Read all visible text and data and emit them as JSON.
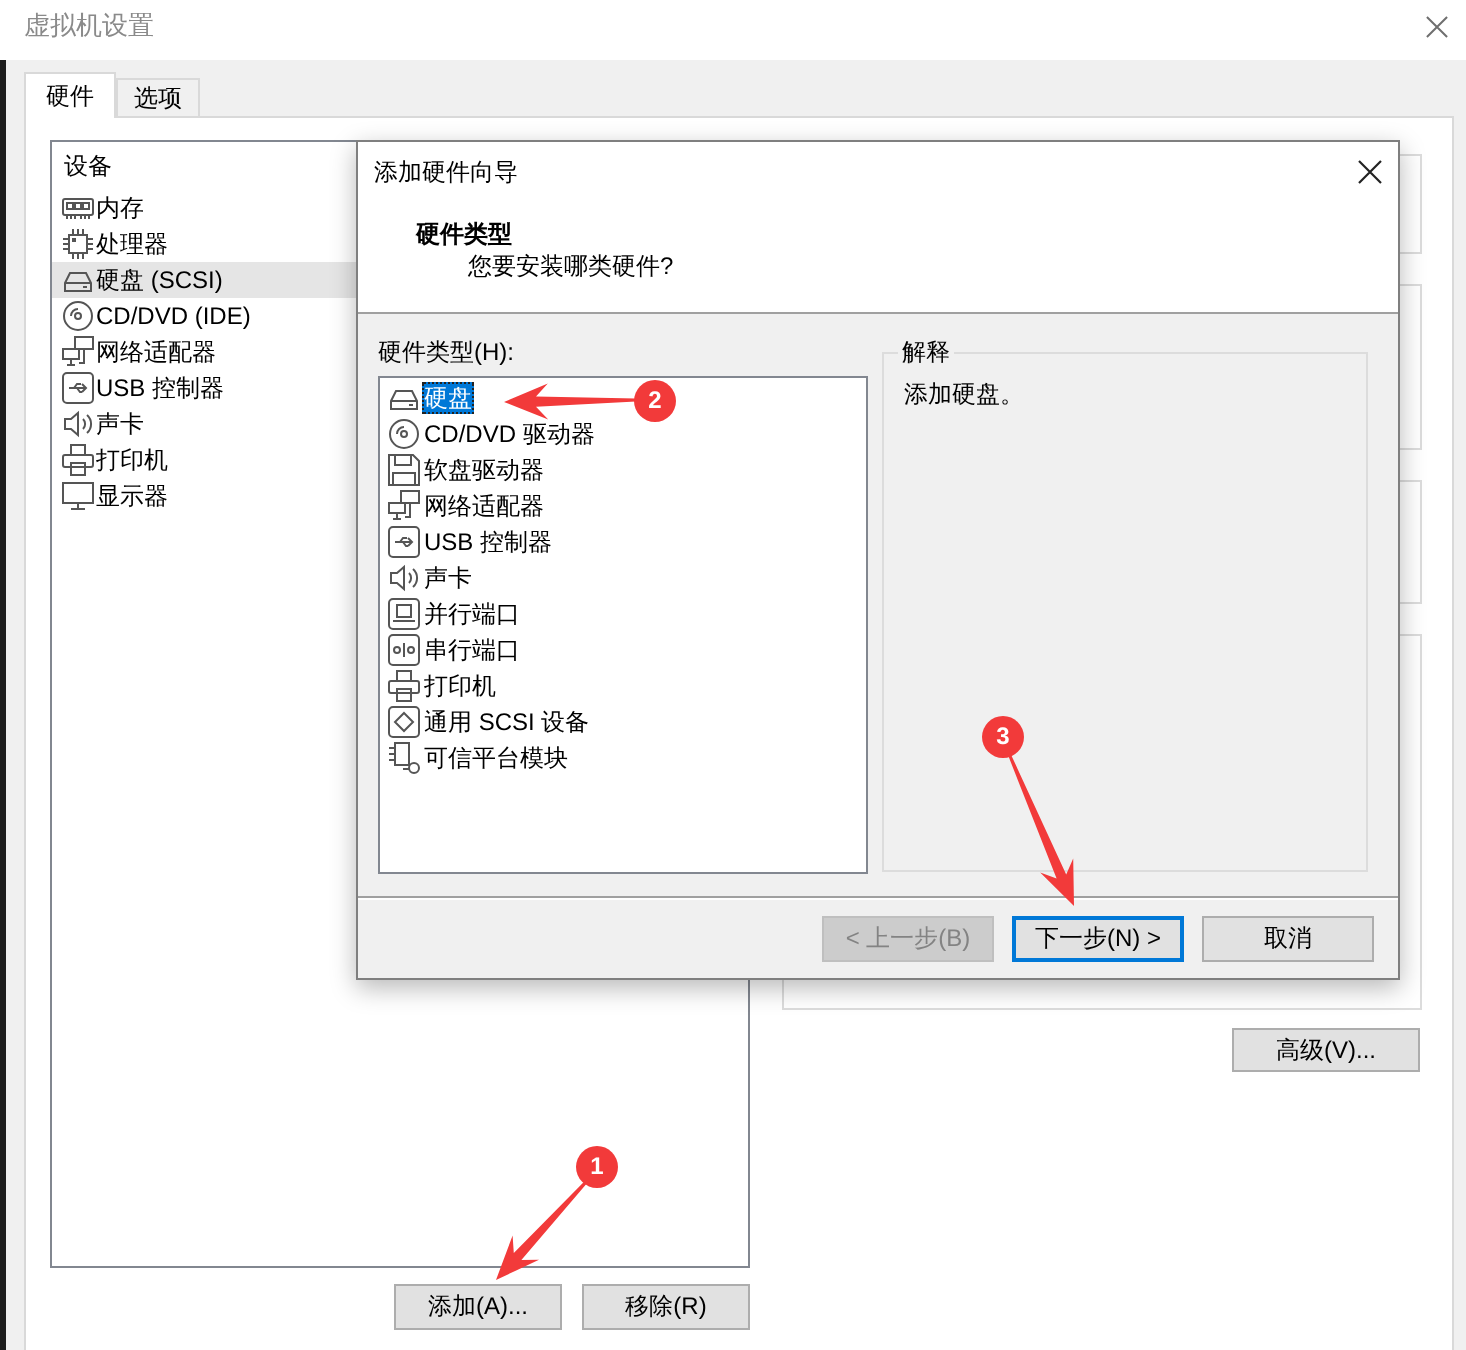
{
  "window": {
    "title": "虚拟机设置"
  },
  "tabs": [
    {
      "label": "硬件",
      "selected": true
    },
    {
      "label": "选项",
      "selected": false
    }
  ],
  "device_list": {
    "header": "设备",
    "items": [
      {
        "label": "内存",
        "kind": "memory",
        "selected": false
      },
      {
        "label": "处理器",
        "kind": "processor",
        "selected": false
      },
      {
        "label": "硬盘 (SCSI)",
        "kind": "hard_disk",
        "selected": true
      },
      {
        "label": "CD/DVD (IDE)",
        "kind": "optical",
        "selected": false
      },
      {
        "label": "网络适配器",
        "kind": "network",
        "selected": false
      },
      {
        "label": "USB 控制器",
        "kind": "usb",
        "selected": false
      },
      {
        "label": "声卡",
        "kind": "sound",
        "selected": false
      },
      {
        "label": "打印机",
        "kind": "printer",
        "selected": false
      },
      {
        "label": "显示器",
        "kind": "display",
        "selected": false
      }
    ]
  },
  "device_buttons": [
    {
      "label": "添加(A)..."
    },
    {
      "label": "移除(R)"
    }
  ],
  "advanced_button": {
    "label": "高级(V)..."
  },
  "wizard": {
    "title": "添加硬件向导",
    "heading": "硬件类型",
    "subheading": "您要安装哪类硬件?",
    "list_label": "硬件类型(H):",
    "items": [
      {
        "label": "硬盘",
        "kind": "hard_disk",
        "selected": true
      },
      {
        "label": "CD/DVD 驱动器",
        "kind": "optical",
        "selected": false
      },
      {
        "label": "软盘驱动器",
        "kind": "floppy",
        "selected": false
      },
      {
        "label": "网络适配器",
        "kind": "network",
        "selected": false
      },
      {
        "label": "USB 控制器",
        "kind": "usb",
        "selected": false
      },
      {
        "label": "声卡",
        "kind": "sound",
        "selected": false
      },
      {
        "label": "并行端口",
        "kind": "parallel",
        "selected": false
      },
      {
        "label": "串行端口",
        "kind": "serial",
        "selected": false
      },
      {
        "label": "打印机",
        "kind": "printer",
        "selected": false
      },
      {
        "label": "通用 SCSI 设备",
        "kind": "scsi",
        "selected": false
      },
      {
        "label": "可信平台模块",
        "kind": "tpm",
        "selected": false
      }
    ],
    "explanation": {
      "title": "解释",
      "text": "添加硬盘。"
    },
    "buttons": [
      {
        "label": "< 上一步(B)",
        "disabled": true,
        "default": false
      },
      {
        "label": "下一步(N) >",
        "disabled": false,
        "default": true
      },
      {
        "label": "取消",
        "disabled": false,
        "default": false
      }
    ]
  },
  "annotations": [
    {
      "number": "1"
    },
    {
      "number": "2"
    },
    {
      "number": "3"
    }
  ]
}
